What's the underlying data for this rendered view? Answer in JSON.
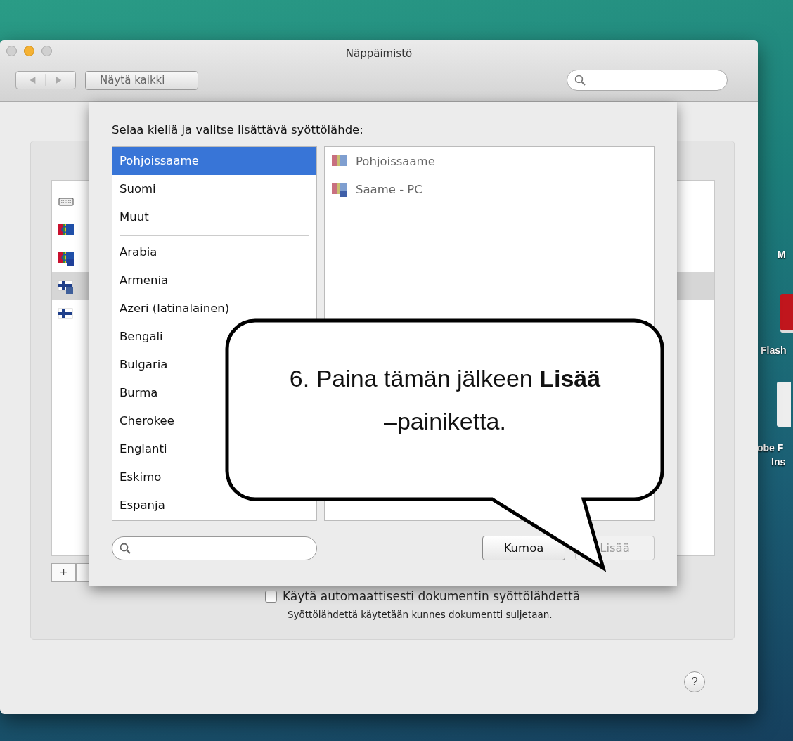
{
  "window": {
    "title": "Näppäimistö",
    "show_all": "Näytä kaikki"
  },
  "input_sources": [
    {
      "kind": "keyboard",
      "selected": false
    },
    {
      "kind": "sami",
      "selected": false
    },
    {
      "kind": "sami-pc",
      "selected": false
    },
    {
      "kind": "finnish-sami",
      "selected": true
    },
    {
      "kind": "finnish",
      "selected": false
    }
  ],
  "add_source": "+",
  "auto_switch": {
    "label": "Käytä automaattisesti dokumentin syöttölähdettä",
    "checked": false,
    "note": "Syöttölähdettä käytetään kunnes dokumentti suljetaan."
  },
  "help": "?",
  "sheet": {
    "prompt": "Selaa kieliä ja valitse lisättävä syöttölähde:",
    "languages": [
      {
        "kind": "item",
        "label": "Pohjoissaame",
        "selected": true
      },
      {
        "kind": "item",
        "label": "Suomi",
        "selected": false
      },
      {
        "kind": "item",
        "label": "Muut",
        "selected": false
      },
      {
        "kind": "separator"
      },
      {
        "kind": "item",
        "label": "Arabia",
        "selected": false
      },
      {
        "kind": "item",
        "label": "Armenia",
        "selected": false
      },
      {
        "kind": "item",
        "label": "Azeri (latinalainen)",
        "selected": false
      },
      {
        "kind": "item",
        "label": "Bengali",
        "selected": false
      },
      {
        "kind": "item",
        "label": "Bulgaria",
        "selected": false
      },
      {
        "kind": "item",
        "label": "Burma",
        "selected": false
      },
      {
        "kind": "item",
        "label": "Cherokee",
        "selected": false
      },
      {
        "kind": "item",
        "label": "Englanti",
        "selected": false
      },
      {
        "kind": "item",
        "label": "Eskimo",
        "selected": false
      },
      {
        "kind": "item",
        "label": "Espanja",
        "selected": false
      }
    ],
    "sources": [
      {
        "kind": "sami",
        "label": "Pohjoissaame"
      },
      {
        "kind": "sami-pc",
        "label": "Saame - PC"
      }
    ],
    "cancel": "Kumoa",
    "add": {
      "label": "Lisää",
      "disabled": true
    }
  },
  "callout": {
    "text": "6. Paina tämän jälkeen **Lisää** –painiketta."
  },
  "desktop_icons": [
    {
      "kind": "none",
      "lines": [
        "M"
      ]
    },
    {
      "kind": "red-drive",
      "lines": [
        "Flash"
      ]
    },
    {
      "kind": "white-drive",
      "lines": [
        "obe F",
        "Ins"
      ]
    }
  ]
}
